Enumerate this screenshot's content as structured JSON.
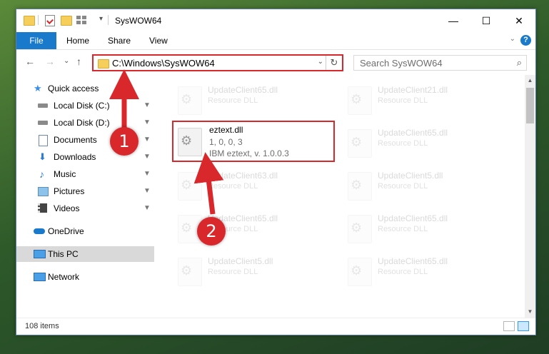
{
  "window": {
    "title": "SysWOW64",
    "minimize_glyph": "—",
    "maximize_glyph": "☐",
    "close_glyph": "✕"
  },
  "ribbon": {
    "tabs": [
      "File",
      "Home",
      "Share",
      "View"
    ],
    "help": "?",
    "expand_glyph": "⌄"
  },
  "nav": {
    "back": "←",
    "forward": "→",
    "recent": "⌄",
    "up": "↑",
    "address": "C:\\Windows\\SysWOW64",
    "address_dropdown": "⌄",
    "refresh": "↻",
    "search_placeholder": "Search SysWOW64",
    "search_glyph": "⌕"
  },
  "sidebar": {
    "items": [
      {
        "label": "Quick access",
        "icon": "star-icon",
        "pinned": false
      },
      {
        "label": "Local Disk (C:)",
        "icon": "drive-icon",
        "pinned": true
      },
      {
        "label": "Local Disk (D:)",
        "icon": "drive-icon",
        "pinned": true
      },
      {
        "label": "Documents",
        "icon": "documents-icon",
        "pinned": true
      },
      {
        "label": "Downloads",
        "icon": "download-icon",
        "pinned": true
      },
      {
        "label": "Music",
        "icon": "music-icon",
        "pinned": true
      },
      {
        "label": "Pictures",
        "icon": "pictures-icon",
        "pinned": true
      },
      {
        "label": "Videos",
        "icon": "videos-icon",
        "pinned": true
      },
      {
        "label": "OneDrive",
        "icon": "cloud-icon",
        "pinned": false
      },
      {
        "label": "This PC",
        "icon": "computer-icon",
        "pinned": false,
        "selected": true
      },
      {
        "label": "Network",
        "icon": "network-icon",
        "pinned": false
      }
    ],
    "pin_glyph": "📌"
  },
  "files": {
    "highlighted": {
      "name": "eztext.dll",
      "version": "1, 0, 0, 3",
      "description": "IBM eztext, v. 1.0.0.3"
    },
    "faded": [
      {
        "name": "UpdateClient65.dll",
        "desc": "Resource DLL"
      },
      {
        "name": "UpdateClient21.dll",
        "desc": "Resource DLL"
      },
      {
        "name": "UpdateClient65.dll",
        "desc": "Resource DLL"
      },
      {
        "name": "UpdateClient63.dll",
        "desc": "Resource DLL"
      },
      {
        "name": "UpdateClient5.dll",
        "desc": "Resource DLL"
      },
      {
        "name": "UpdateClient65.dll",
        "desc": "Resource DLL"
      },
      {
        "name": "UpdateClient65.dll",
        "desc": "Resource DLL"
      },
      {
        "name": "UpdateClient5.dll",
        "desc": "Resource DLL"
      },
      {
        "name": "UpdateClient65.dll",
        "desc": "Resource DLL"
      }
    ]
  },
  "status": {
    "count": "108 items"
  },
  "annotations": {
    "step1": "1",
    "step2": "2"
  },
  "colors": {
    "accent": "#1979ca",
    "highlight": "#d9282c"
  }
}
